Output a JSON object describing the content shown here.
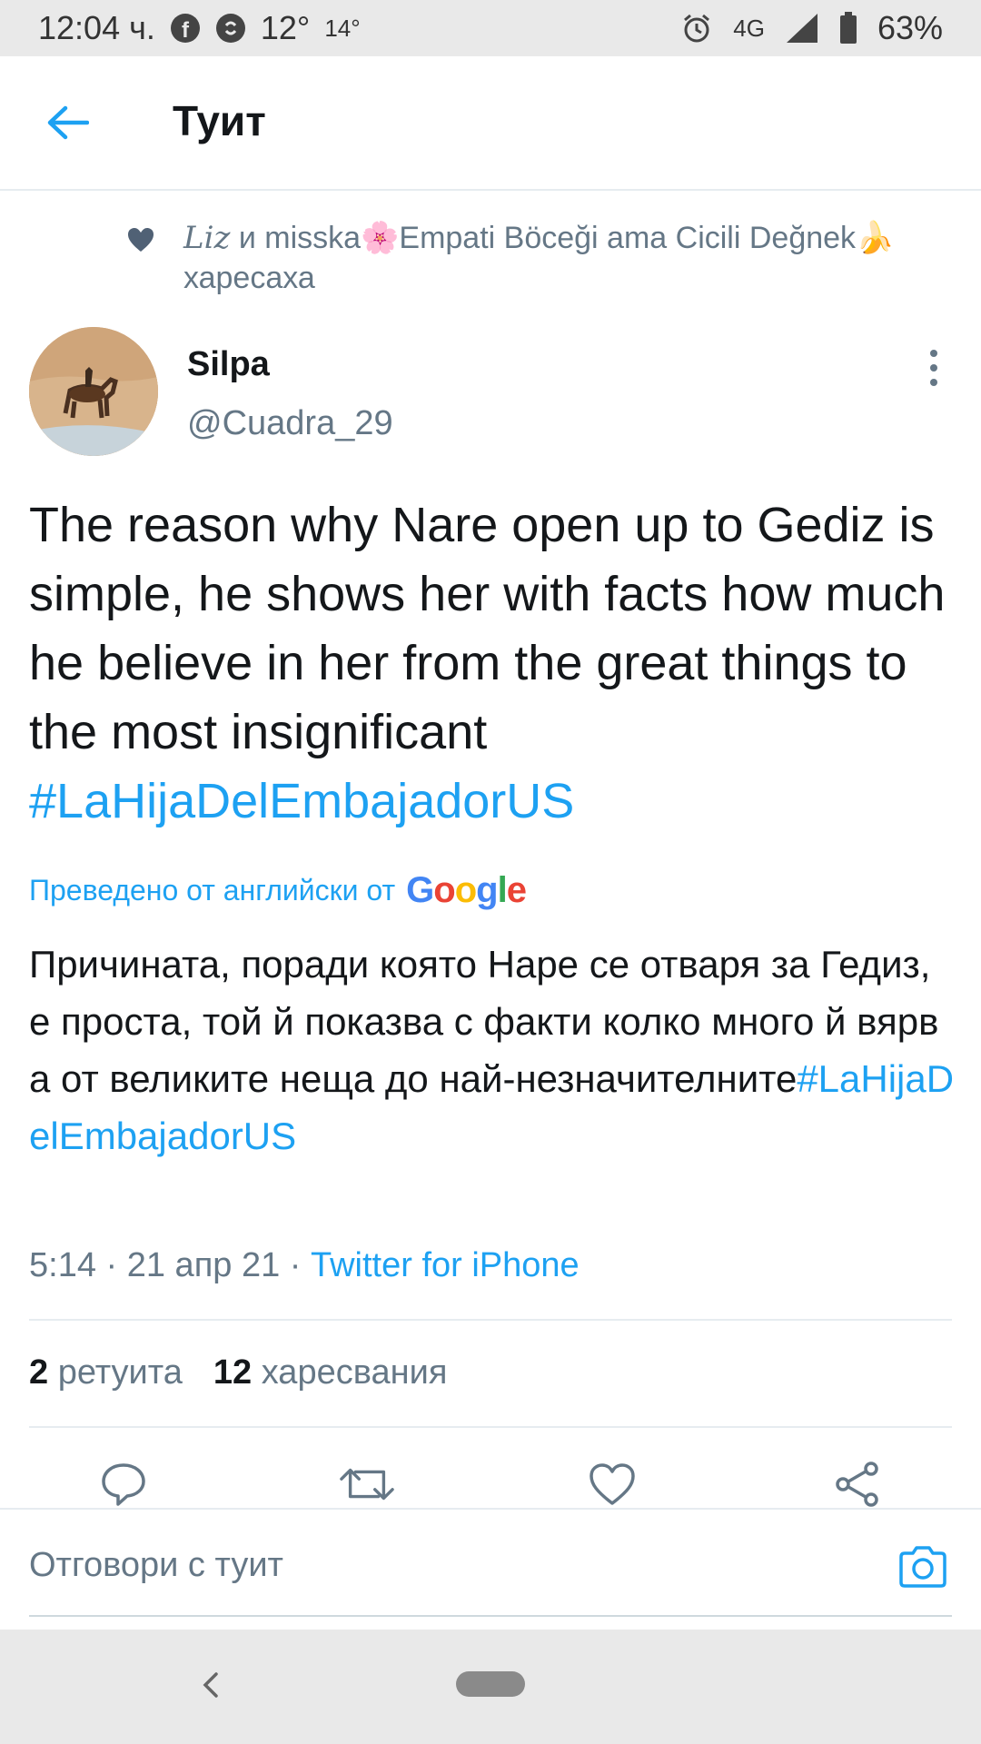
{
  "status_bar": {
    "time": "12:04 ч.",
    "temp1": "12°",
    "temp2": "14°",
    "network": "4G",
    "battery": "63%"
  },
  "header": {
    "title": "Туит"
  },
  "social_context": {
    "liz": "Liz",
    "text": "и misska🌸Empati Böceği ama Cicili Değnek🍌",
    "action": "харесаха"
  },
  "author": {
    "name": "Silpa",
    "handle": "@Cuadra_29"
  },
  "tweet": {
    "text": "The reason why Nare open up to Gediz is simple, he shows her with facts how much he believe in her from the great things to the most insignificant ",
    "hashtag": "#LaHijaDelEmbajadorUS",
    "translated_label": "Преведено от английски от",
    "translation_text": "Причината, поради която Наре се отваря за Гедиз, е проста, той й показва с факти колко много й вярва от великите неща до най-незначителните",
    "translation_hashtag": "#LaHijaDelEmbajadorUS",
    "time": "5:14 · 21 апр 21 · ",
    "source": "Twitter for iPhone"
  },
  "stats": {
    "retweets_count": "2",
    "retweets_label": "ретуита",
    "likes_count": "12",
    "likes_label": "харесвания"
  },
  "reply": {
    "placeholder": "Отговори с туит"
  },
  "colors": {
    "accent": "#1da1f2",
    "secondary_text": "#657786",
    "primary_text": "#14171a"
  }
}
